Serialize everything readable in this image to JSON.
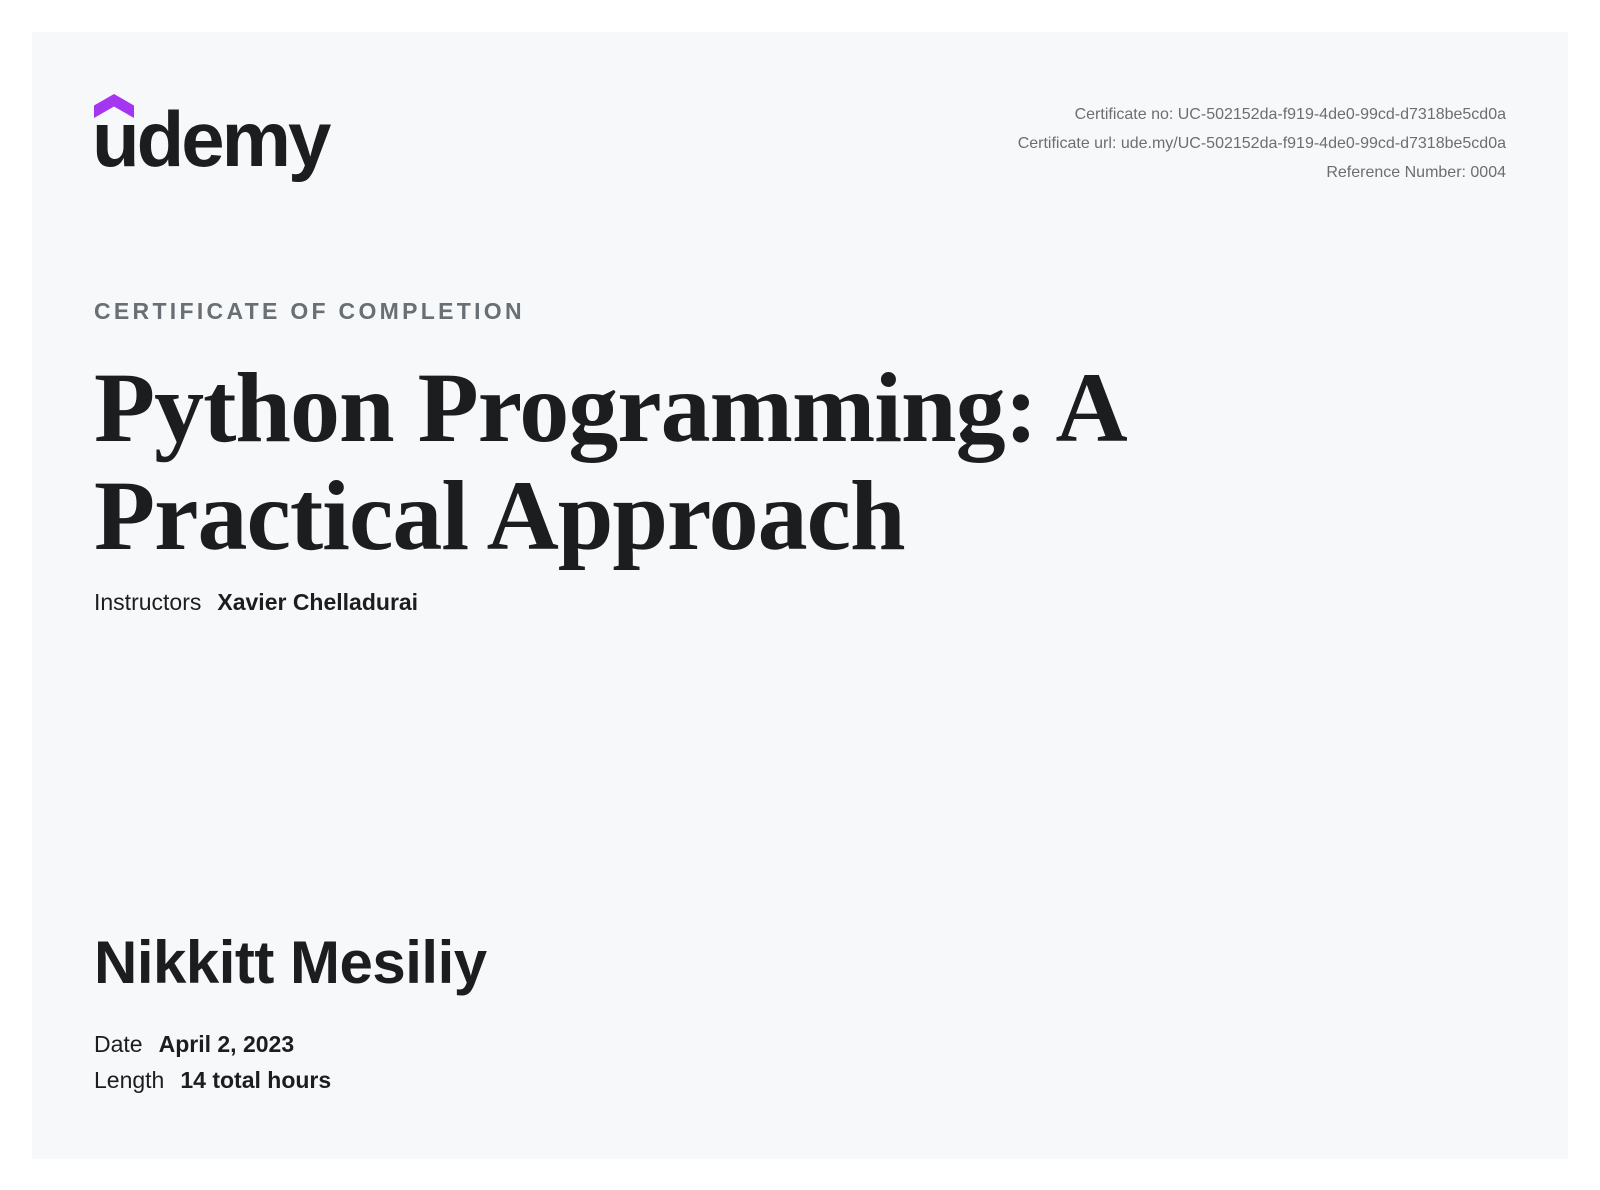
{
  "brand": {
    "logo_text": "udemy",
    "hat_color": "#a435f0"
  },
  "meta": {
    "certificate_no": "Certificate no: UC-502152da-f919-4de0-99cd-d7318be5cd0a",
    "certificate_url": "Certificate url: ude.my/UC-502152da-f919-4de0-99cd-d7318be5cd0a",
    "reference_number": "Reference Number: 0004"
  },
  "certificate": {
    "kicker": "CERTIFICATE OF COMPLETION",
    "course_title": "Python Programming: A Practical Approach",
    "instructors_label": "Instructors",
    "instructors_value": "Xavier Chelladurai",
    "recipient_name": "Nikkitt Mesiliy",
    "date_label": "Date",
    "date_value": "April 2, 2023",
    "length_label": "Length",
    "length_value": "14 total hours"
  },
  "colors": {
    "background": "#f7f8fa",
    "text_primary": "#1c1d1f",
    "text_secondary": "#6a6f73",
    "brand_purple": "#a435f0"
  }
}
